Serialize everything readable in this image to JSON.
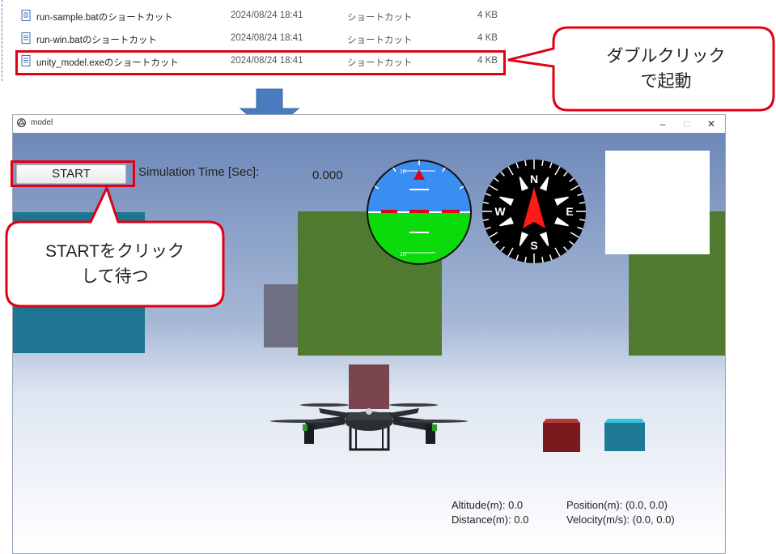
{
  "file_list": {
    "rows": [
      {
        "name": "run-sample.batのショートカット",
        "date": "2024/08/24 18:41",
        "type": "ショートカット",
        "size": "4 KB"
      },
      {
        "name": "run-win.batのショートカット",
        "date": "2024/08/24 18:41",
        "type": "ショートカット",
        "size": "4 KB"
      },
      {
        "name": "unity_model.exeのショートカット",
        "date": "2024/08/24 18:41",
        "type": "ショートカット",
        "size": "4 KB"
      }
    ]
  },
  "callouts": {
    "double_click": [
      "ダブルクリック",
      "で起動"
    ],
    "start_click": [
      "STARTをクリック",
      "して待つ"
    ]
  },
  "window": {
    "title": "model",
    "minimize": "–",
    "maximize": "□",
    "close": "✕"
  },
  "sim": {
    "start_label": "START",
    "time_label": "Simulation Time [Sec]:",
    "time_value": "0.000"
  },
  "attitude": {
    "top_mark": "10",
    "bottom_mark": "10"
  },
  "compass": {
    "n": "N",
    "s": "S",
    "e": "E",
    "w": "W"
  },
  "hud": {
    "altitude": "Altitude(m): 0.0",
    "distance": "Distance(m): 0.0",
    "position": "Position(m): (0.0, 0.0)",
    "velocity": "Velocity(m/s): (0.0, 0.0)"
  },
  "colors": {
    "highlight": "#e00012",
    "sky_top": "#6d88b8",
    "ground": "#e9edf5",
    "green_block": "#4f7a2f",
    "teal_block": "#1e7592",
    "arrow": "#4a7bbf"
  }
}
